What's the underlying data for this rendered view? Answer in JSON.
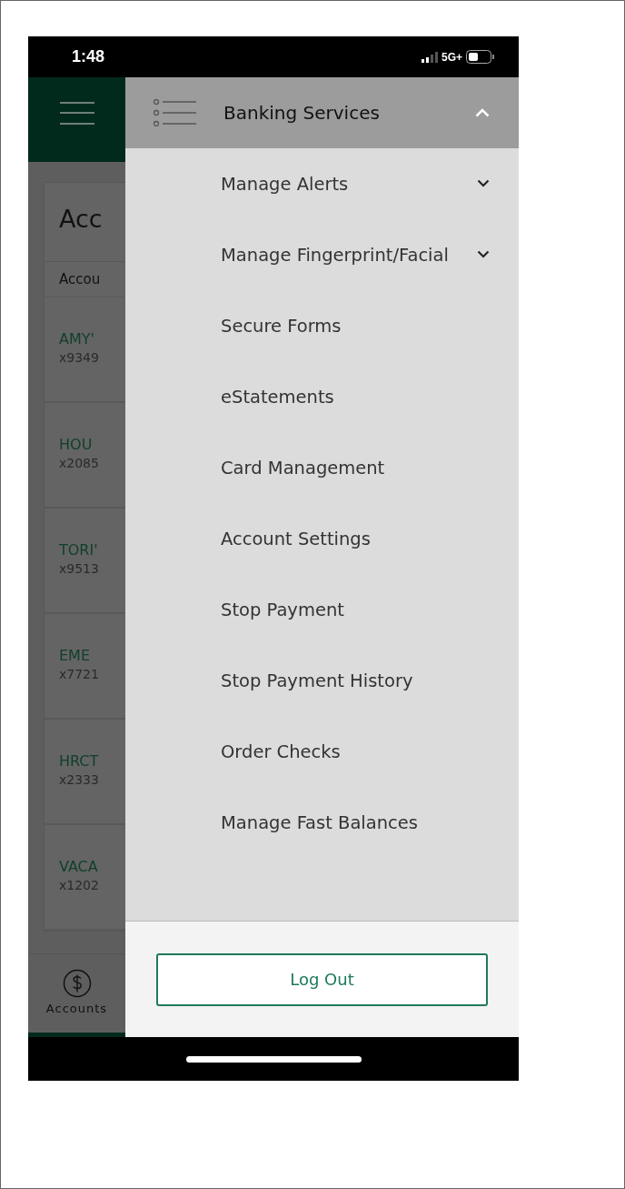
{
  "status_bar": {
    "time": "1:48",
    "network": "5G+"
  },
  "background": {
    "title": "Acc",
    "section": "Accou",
    "accounts": [
      {
        "name": "AMY'",
        "number": "x9349"
      },
      {
        "name": "HOU",
        "number": "x2085"
      },
      {
        "name": "TORI'",
        "number": "x9513"
      },
      {
        "name": "EME",
        "number": "x7721"
      },
      {
        "name": "HRCT",
        "number": "x2333"
      },
      {
        "name": "VACA",
        "number": "x1202"
      }
    ],
    "bottom_nav": [
      {
        "label": "Accounts"
      }
    ]
  },
  "drawer": {
    "header": {
      "title": "Banking Services",
      "expanded": true
    },
    "items": [
      {
        "label": "Manage Alerts",
        "kind": "expandable",
        "expanded": false
      },
      {
        "label": "Manage Fingerprint/Facial",
        "kind": "expandable",
        "expanded": false
      },
      {
        "label": "Secure Forms",
        "kind": "link"
      },
      {
        "label": "eStatements",
        "kind": "link"
      },
      {
        "label": "Card Management",
        "kind": "link"
      },
      {
        "label": "Account Settings",
        "kind": "link"
      },
      {
        "label": "Stop Payment",
        "kind": "link"
      },
      {
        "label": "Stop Payment History",
        "kind": "link"
      },
      {
        "label": "Order Checks",
        "kind": "link"
      },
      {
        "label": "Manage Fast Balances",
        "kind": "link"
      }
    ],
    "logout": "Log Out"
  }
}
